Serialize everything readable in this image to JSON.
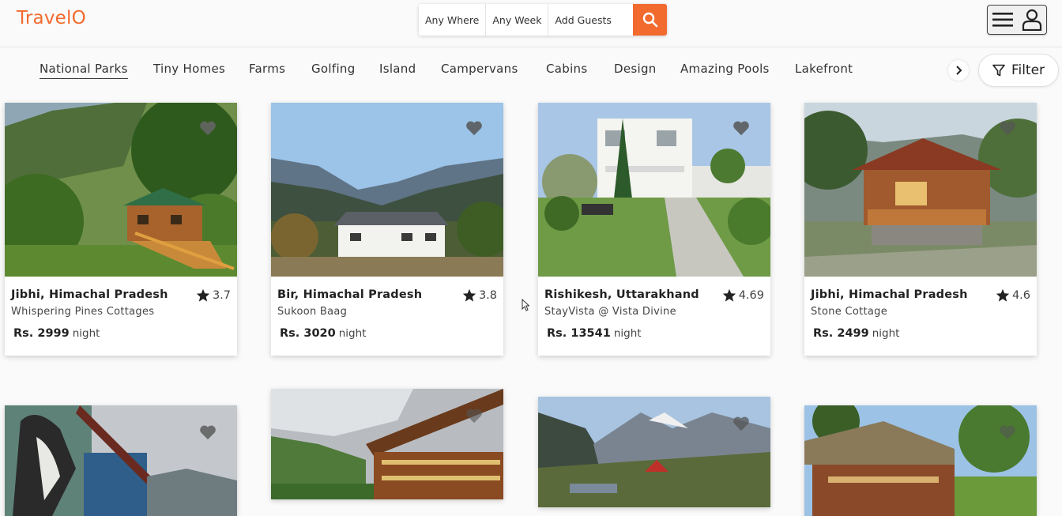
{
  "brand": {
    "logo": "TravelO",
    "accent": "#f26a2e"
  },
  "search": {
    "where": "Any Where",
    "week": "Any Week",
    "guests": "Add Guests"
  },
  "categories": [
    "National Parks",
    "Tiny Homes",
    "Farms",
    "Golfing",
    "Island",
    "Campervans",
    "Cabins",
    "Design",
    "Amazing Pools",
    "Lakefront"
  ],
  "filter_label": "Filter",
  "listings": [
    {
      "location": "Jibhi, Himachal Pradesh",
      "name": "Whispering Pines Cottages",
      "price": "Rs. 2999",
      "unit": "night",
      "rating": "3.7"
    },
    {
      "location": "Bir, Himachal Pradesh",
      "name": "Sukoon Baag",
      "price": "Rs. 3020",
      "unit": "night",
      "rating": "3.8"
    },
    {
      "location": "Rishikesh, Uttarakhand",
      "name": "StayVista @ Vista Divine",
      "price": "Rs. 13541",
      "unit": "night",
      "rating": "4.69"
    },
    {
      "location": "Jibhi, Himachal Pradesh",
      "name": "Stone Cottage",
      "price": "Rs. 2499",
      "unit": "night",
      "rating": "4.6"
    }
  ]
}
